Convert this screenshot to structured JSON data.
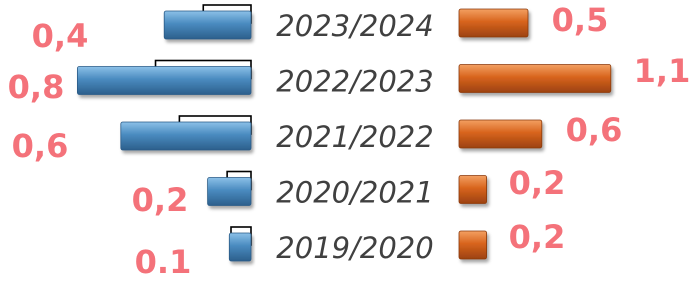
{
  "colors": {
    "left_bar": "#4a8bc0",
    "right_bar": "#d8641d",
    "value_label": "#f4727a",
    "category_label": "#404040"
  },
  "chart_data": {
    "type": "bar",
    "orientation": "horizontal",
    "layout": "back-to-back",
    "categories": [
      "2023/2024",
      "2022/2023",
      "2021/2022",
      "2020/2021",
      "2019/2020"
    ],
    "series": [
      {
        "side": "left",
        "values": [
          0.4,
          0.8,
          0.6,
          0.2,
          0.1
        ],
        "labels": [
          "0,4",
          "0,8",
          "0,6",
          "0,2",
          "0.1"
        ]
      },
      {
        "side": "right",
        "values": [
          0.5,
          1.1,
          0.6,
          0.2,
          0.2
        ],
        "labels": [
          "0,5",
          "1,1",
          "0,6",
          "0,2",
          "0,2"
        ]
      }
    ]
  }
}
